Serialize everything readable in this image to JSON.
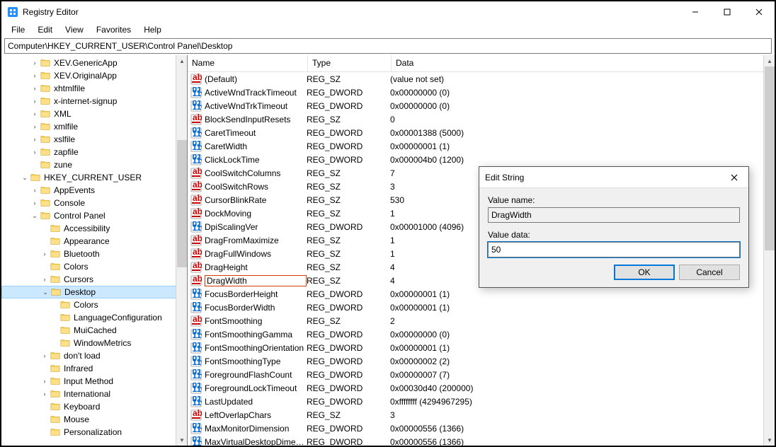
{
  "window": {
    "title": "Registry Editor"
  },
  "menu": [
    "File",
    "Edit",
    "View",
    "Favorites",
    "Help"
  ],
  "address": "Computer\\HKEY_CURRENT_USER\\Control Panel\\Desktop",
  "tree_upper": [
    {
      "lvl": 2,
      "exp": ">",
      "label": "XEV.GenericApp"
    },
    {
      "lvl": 2,
      "exp": ">",
      "label": "XEV.OriginalApp"
    },
    {
      "lvl": 2,
      "exp": ">",
      "label": "xhtmlfile"
    },
    {
      "lvl": 2,
      "exp": ">",
      "label": "x-internet-signup"
    },
    {
      "lvl": 2,
      "exp": ">",
      "label": "XML"
    },
    {
      "lvl": 2,
      "exp": ">",
      "label": "xmlfile"
    },
    {
      "lvl": 2,
      "exp": ">",
      "label": "xslfile"
    },
    {
      "lvl": 2,
      "exp": ">",
      "label": "zapfile"
    },
    {
      "lvl": 2,
      "exp": "",
      "label": "zune"
    }
  ],
  "tree_hkcu": {
    "lvl": 1,
    "exp": "v",
    "label": "HKEY_CURRENT_USER"
  },
  "tree_hkcu_children": [
    {
      "lvl": 2,
      "exp": ">",
      "label": "AppEvents"
    },
    {
      "lvl": 2,
      "exp": ">",
      "label": "Console"
    }
  ],
  "tree_cp": {
    "lvl": 2,
    "exp": "v",
    "label": "Control Panel"
  },
  "tree_cp_children_pre": [
    {
      "lvl": 3,
      "exp": "",
      "label": "Accessibility"
    },
    {
      "lvl": 3,
      "exp": "",
      "label": "Appearance"
    },
    {
      "lvl": 3,
      "exp": ">",
      "label": "Bluetooth"
    },
    {
      "lvl": 3,
      "exp": "",
      "label": "Colors"
    },
    {
      "lvl": 3,
      "exp": ">",
      "label": "Cursors"
    }
  ],
  "tree_desktop": {
    "lvl": 3,
    "exp": "v",
    "label": "Desktop",
    "selected": true
  },
  "tree_desktop_children": [
    {
      "lvl": 4,
      "exp": "",
      "label": "Colors"
    },
    {
      "lvl": 4,
      "exp": "",
      "label": "LanguageConfiguration"
    },
    {
      "lvl": 4,
      "exp": "",
      "label": "MuiCached"
    },
    {
      "lvl": 4,
      "exp": "",
      "label": "WindowMetrics"
    }
  ],
  "tree_cp_children_post": [
    {
      "lvl": 3,
      "exp": ">",
      "label": "don't load"
    },
    {
      "lvl": 3,
      "exp": "",
      "label": "Infrared"
    },
    {
      "lvl": 3,
      "exp": ">",
      "label": "Input Method"
    },
    {
      "lvl": 3,
      "exp": ">",
      "label": "International"
    },
    {
      "lvl": 3,
      "exp": "",
      "label": "Keyboard"
    },
    {
      "lvl": 3,
      "exp": "",
      "label": "Mouse"
    },
    {
      "lvl": 3,
      "exp": "",
      "label": "Personalization"
    }
  ],
  "columns": {
    "name": "Name",
    "type": "Type",
    "data": "Data"
  },
  "values": [
    {
      "icon": "sz",
      "name": "(Default)",
      "type": "REG_SZ",
      "data": "(value not set)"
    },
    {
      "icon": "dw",
      "name": "ActiveWndTrackTimeout",
      "type": "REG_DWORD",
      "data": "0x00000000 (0)"
    },
    {
      "icon": "dw",
      "name": "ActiveWndTrkTimeout",
      "type": "REG_DWORD",
      "data": "0x00000000 (0)"
    },
    {
      "icon": "sz",
      "name": "BlockSendInputResets",
      "type": "REG_SZ",
      "data": "0"
    },
    {
      "icon": "dw",
      "name": "CaretTimeout",
      "type": "REG_DWORD",
      "data": "0x00001388 (5000)"
    },
    {
      "icon": "dw",
      "name": "CaretWidth",
      "type": "REG_DWORD",
      "data": "0x00000001 (1)"
    },
    {
      "icon": "dw",
      "name": "ClickLockTime",
      "type": "REG_DWORD",
      "data": "0x000004b0 (1200)"
    },
    {
      "icon": "sz",
      "name": "CoolSwitchColumns",
      "type": "REG_SZ",
      "data": "7"
    },
    {
      "icon": "sz",
      "name": "CoolSwitchRows",
      "type": "REG_SZ",
      "data": "3"
    },
    {
      "icon": "sz",
      "name": "CursorBlinkRate",
      "type": "REG_SZ",
      "data": "530"
    },
    {
      "icon": "sz",
      "name": "DockMoving",
      "type": "REG_SZ",
      "data": "1"
    },
    {
      "icon": "dw",
      "name": "DpiScalingVer",
      "type": "REG_DWORD",
      "data": "0x00001000 (4096)"
    },
    {
      "icon": "sz",
      "name": "DragFromMaximize",
      "type": "REG_SZ",
      "data": "1"
    },
    {
      "icon": "sz",
      "name": "DragFullWindows",
      "type": "REG_SZ",
      "data": "1"
    },
    {
      "icon": "sz",
      "name": "DragHeight",
      "type": "REG_SZ",
      "data": "4"
    },
    {
      "icon": "sz",
      "name": "DragWidth",
      "type": "REG_SZ",
      "data": "4",
      "highlighted": true
    },
    {
      "icon": "dw",
      "name": "FocusBorderHeight",
      "type": "REG_DWORD",
      "data": "0x00000001 (1)"
    },
    {
      "icon": "dw",
      "name": "FocusBorderWidth",
      "type": "REG_DWORD",
      "data": "0x00000001 (1)"
    },
    {
      "icon": "sz",
      "name": "FontSmoothing",
      "type": "REG_SZ",
      "data": "2"
    },
    {
      "icon": "dw",
      "name": "FontSmoothingGamma",
      "type": "REG_DWORD",
      "data": "0x00000000 (0)"
    },
    {
      "icon": "dw",
      "name": "FontSmoothingOrientation",
      "type": "REG_DWORD",
      "data": "0x00000001 (1)"
    },
    {
      "icon": "dw",
      "name": "FontSmoothingType",
      "type": "REG_DWORD",
      "data": "0x00000002 (2)"
    },
    {
      "icon": "dw",
      "name": "ForegroundFlashCount",
      "type": "REG_DWORD",
      "data": "0x00000007 (7)"
    },
    {
      "icon": "dw",
      "name": "ForegroundLockTimeout",
      "type": "REG_DWORD",
      "data": "0x00030d40 (200000)"
    },
    {
      "icon": "dw",
      "name": "LastUpdated",
      "type": "REG_DWORD",
      "data": "0xffffffff (4294967295)"
    },
    {
      "icon": "sz",
      "name": "LeftOverlapChars",
      "type": "REG_SZ",
      "data": "3"
    },
    {
      "icon": "dw",
      "name": "MaxMonitorDimension",
      "type": "REG_DWORD",
      "data": "0x00000556 (1366)"
    },
    {
      "icon": "dw",
      "name": "MaxVirtualDesktopDimen...",
      "type": "REG_DWORD",
      "data": "0x00000556 (1366)"
    }
  ],
  "dialog": {
    "title": "Edit String",
    "value_name_label": "Value name:",
    "value_name": "DragWidth",
    "value_data_label": "Value data:",
    "value_data": "50",
    "ok": "OK",
    "cancel": "Cancel"
  }
}
